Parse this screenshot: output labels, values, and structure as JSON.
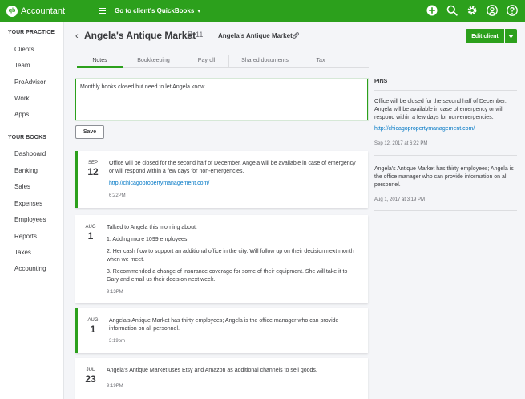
{
  "app": {
    "name": "Accountant",
    "logo": "qb",
    "goto_label": "Go to client's QuickBooks"
  },
  "sidebar": {
    "your_practice_label": "YOUR PRACTICE",
    "practice_items": [
      "Clients",
      "Team",
      "ProAdvisor",
      "Work",
      "Apps"
    ],
    "your_books_label": "YOUR BOOKS",
    "books_items": [
      "Dashboard",
      "Banking",
      "Sales",
      "Expenses",
      "Employees",
      "Reports",
      "Taxes",
      "Accounting"
    ]
  },
  "client": {
    "title": "Angela's Antique Market",
    "people_count": "11",
    "subtitle": "Angela's Antique Market",
    "edit_label": "Edit client"
  },
  "tabs": [
    "Notes",
    "Bookkeeping",
    "Payroll",
    "Shared documents",
    "Tax"
  ],
  "note_input": {
    "value": "Monthly books closed but need to let Angela know."
  },
  "save_label": "Save",
  "notes": [
    {
      "month": "SEP",
      "day": "12",
      "pinned": true,
      "paragraphs": [
        "Office will be closed for the second half of December. Angela will be available in case of emergency or will respond within a few days for non-emergencies."
      ],
      "link": "http://chicagopropertymanagement.com/",
      "time": "6:22PM"
    },
    {
      "month": "AUG",
      "day": "1",
      "pinned": false,
      "paragraphs": [
        "Talked to Angela this morning about:",
        "1. Adding more 1099 employees",
        "2. Her cash flow to support an additional office in the city. Will follow up on their decision next month when we meet.",
        "3. Recommended a change of insurance coverage for some of their equipment. She will take it to Gary and email us their decision next week."
      ],
      "time": "9:13PM"
    },
    {
      "month": "AUG",
      "day": "1",
      "pinned": true,
      "paragraphs": [
        "Angela's Antique Market has thirty employees; Angela is the office manager who can provide information on all personnel."
      ],
      "time": "3:19pm"
    },
    {
      "month": "JUL",
      "day": "23",
      "pinned": false,
      "paragraphs": [
        "Angela's Antique Market uses Etsy and Amazon as additional channels to sell goods."
      ],
      "time": "9:19PM"
    }
  ],
  "pins": {
    "label": "PINS",
    "items": [
      {
        "text": "Office will be closed for the second half of December. Angela will be available in case of emergency or will respond within a few days for non-emergencies.",
        "link": "http://chicagopropertymanagement.com/",
        "time": "Sep 12, 2017 at 6:22 PM"
      },
      {
        "text": "Angela's Antique Market has thirty employees; Angela is the office manager who can provide information on all personnel.",
        "time": "Aug 1, 2017 at 3:19 PM"
      }
    ]
  },
  "colors": {
    "brand": "#2ca01c",
    "link": "#0077c5",
    "text": "#393a3d",
    "muted": "#6b6c72",
    "background": "#f4f5f8"
  },
  "icons": {
    "new": "plus-circle-icon",
    "search": "search-icon",
    "settings": "gear-icon",
    "profile": "user-icon",
    "help": "help-icon"
  }
}
